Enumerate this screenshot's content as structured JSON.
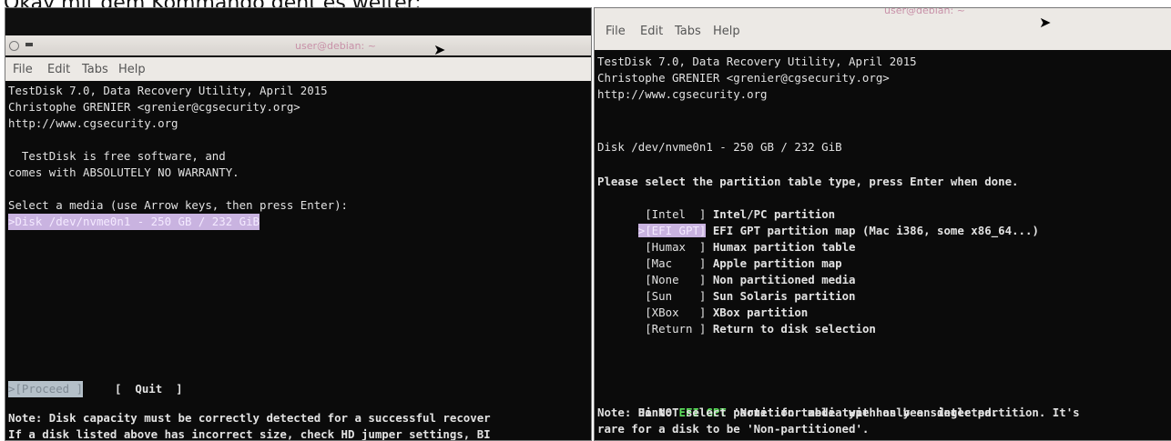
{
  "caption": "Okay mit dem Kommando geht es weiter:",
  "left_window": {
    "title": "user@debian: ~",
    "menu": [
      "File",
      "Edit",
      "Tabs",
      "Help"
    ],
    "lines": [
      "TestDisk 7.0, Data Recovery Utility, April 2015",
      "Christophe GRENIER <grenier@cgsecurity.org>",
      "http://www.cgsecurity.org",
      "",
      "  TestDisk is free software, and",
      "comes with ABSOLUTELY NO WARRANTY.",
      "",
      "Select a media (use Arrow keys, then press Enter):"
    ],
    "selected_media": ">Disk /dev/nvme0n1 - 250 GB / 232 GiB",
    "proceed": ">[Proceed ]",
    "quit": "[  Quit  ]",
    "note1": "Note: Disk capacity must be correctly detected for a successful recover",
    "note2": "If a disk listed above has incorrect size, check HD jumper settings, BI"
  },
  "right_window": {
    "title": "user@debian: ~",
    "menu": [
      "File",
      "Edit",
      "Tabs",
      "Help"
    ],
    "header_lines": [
      "TestDisk 7.0, Data Recovery Utility, April 2015",
      "Christophe GRENIER <grenier@cgsecurity.org>",
      "http://www.cgsecurity.org"
    ],
    "disk": "Disk /dev/nvme0n1 - 250 GB / 232 GiB",
    "prompt": "Please select the partition table type, press Enter when done.",
    "options": [
      {
        "key": " [Intel  ]",
        "label": " Intel/PC partition"
      },
      {
        "key": ">[EFI GPT]",
        "label": " EFI GPT partition map (Mac i386, some x86_64...)"
      },
      {
        "key": " [Humax  ]",
        "label": " Humax partition table"
      },
      {
        "key": " [Mac    ]",
        "label": " Apple partition map"
      },
      {
        "key": " [None   ]",
        "label": " Non partitioned media"
      },
      {
        "key": " [Sun    ]",
        "label": " Sun Solaris partition"
      },
      {
        "key": " [XBox   ]",
        "label": " XBox partition"
      },
      {
        "key": " [Return ]",
        "label": " Return to disk selection"
      }
    ],
    "hint_prefix": "Hint: ",
    "hint_type": "EFI GPT",
    "hint_suffix": " partition table type has been detected.",
    "note1": "Note: Do NOT select 'None' for media with only a single partition. It's",
    "note2": "rare for a disk to be 'Non-partitioned'."
  }
}
